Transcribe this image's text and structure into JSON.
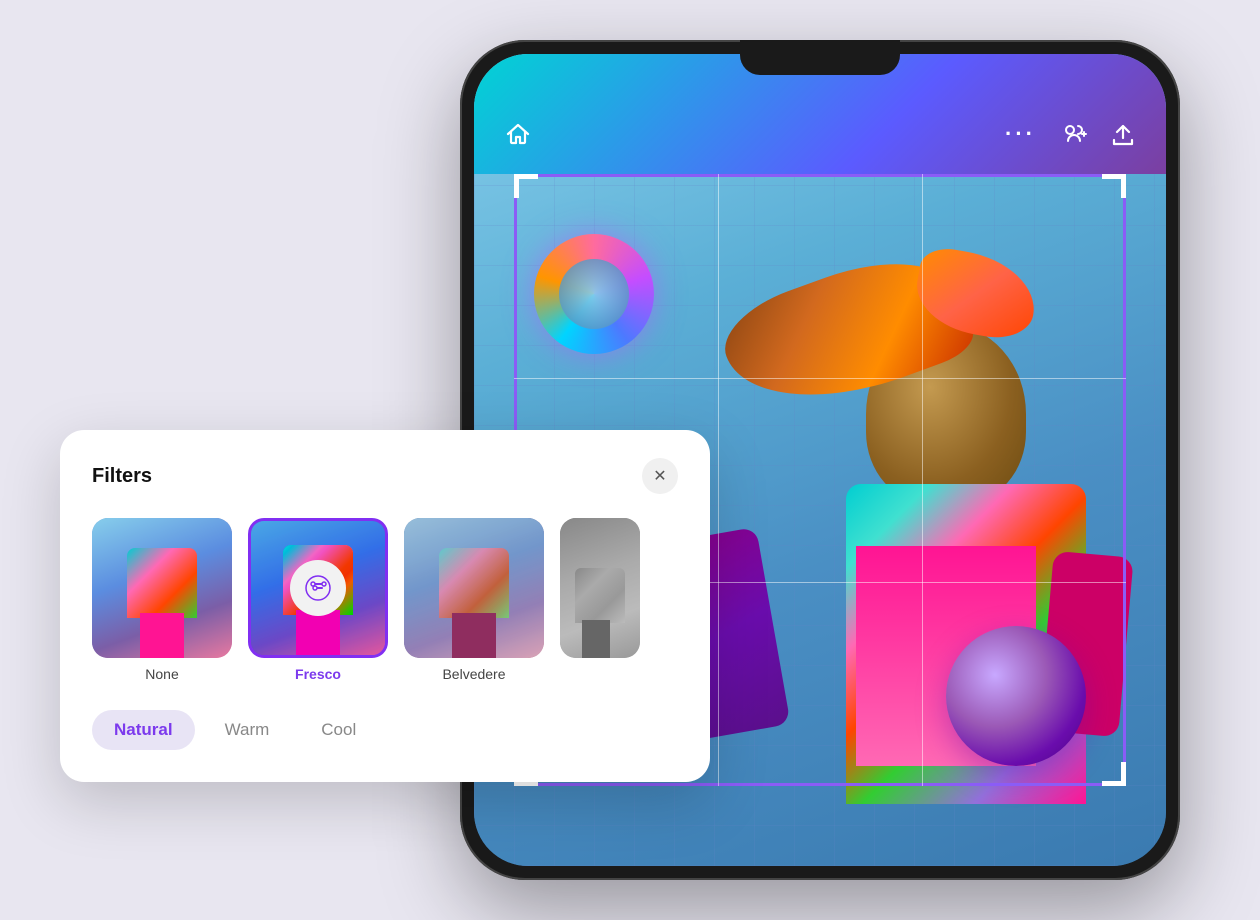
{
  "background_color": "#e8e6f0",
  "phone": {
    "topbar": {
      "home_icon": "⌂",
      "more_icon": "•••",
      "add_friend_icon": "👥",
      "share_icon": "↑"
    },
    "image_alt": "Woman with braids jumping with colorful jacket"
  },
  "filters_panel": {
    "title": "Filters",
    "close_label": "✕",
    "filters": [
      {
        "id": "none",
        "label": "None",
        "selected": false
      },
      {
        "id": "fresco",
        "label": "Fresco",
        "selected": true
      },
      {
        "id": "belvedere",
        "label": "Belvedere",
        "selected": false
      },
      {
        "id": "fourth",
        "label": "",
        "selected": false
      }
    ],
    "tones": [
      {
        "id": "natural",
        "label": "Natural",
        "active": true
      },
      {
        "id": "warm",
        "label": "Warm",
        "active": false
      },
      {
        "id": "cool",
        "label": "Cool",
        "active": false
      }
    ]
  }
}
